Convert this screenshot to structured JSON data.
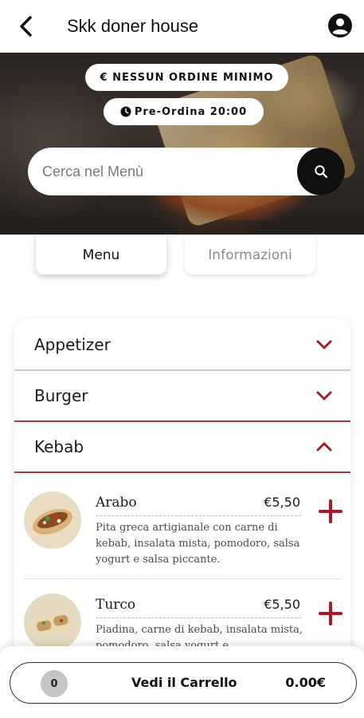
{
  "header": {
    "title": "Skk doner house",
    "back_icon": "back-chevron-icon",
    "account_icon": "account-circle-icon"
  },
  "hero": {
    "min_order_badge": "€ NESSUN ORDINE MINIMO",
    "preorder_badge": "Pre-Ordina 20:00",
    "preorder_icon": "clock-icon",
    "search_placeholder": "Cerca nel Menù",
    "search_icon": "search-icon"
  },
  "tabs": [
    {
      "label": "Menu",
      "active": true
    },
    {
      "label": "Informazioni",
      "active": false
    }
  ],
  "categories": [
    {
      "label": "Appetizer",
      "expanded": false
    },
    {
      "label": "Burger",
      "expanded": false
    },
    {
      "label": "Kebab",
      "expanded": true
    }
  ],
  "items": [
    {
      "name": "Arabo",
      "price": "€5,50",
      "description": "Pita greca artigianale con carne di kebab, insalata mista, pomodoro, salsa yogurt e salsa piccante."
    },
    {
      "name": "Turco",
      "price": "€5,50",
      "description": "Piadina, carne di kebab, insalata mista, pomodoro, salsa yogurt e..."
    }
  ],
  "cart": {
    "count": "0",
    "label": "Vedi il Carrello",
    "total": "0.00€"
  },
  "colors": {
    "accent": "#a11d2a",
    "dark": "#101010"
  }
}
